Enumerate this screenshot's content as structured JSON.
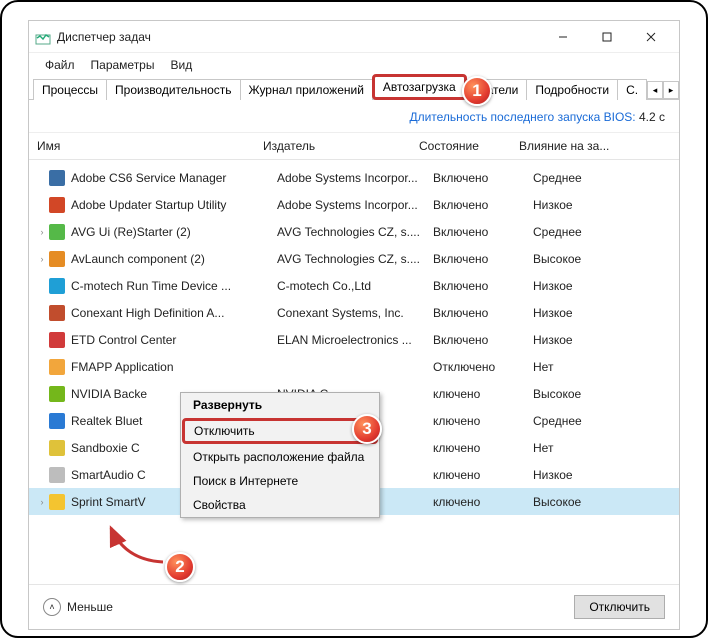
{
  "window": {
    "title": "Диспетчер задач"
  },
  "menu": {
    "file": "Файл",
    "options": "Параметры",
    "view": "Вид"
  },
  "tabs": {
    "t0": "Процессы",
    "t1": "Производительность",
    "t2": "Журнал приложений",
    "t3": "Автозагрузка",
    "t4_partial": "ователи",
    "t5": "Подробности",
    "t6_partial": "С."
  },
  "bios": {
    "label": "Длительность последнего запуска BIOS:",
    "value": "4.2 с"
  },
  "cols": {
    "name": "Имя",
    "publisher": "Издатель",
    "status": "Состояние",
    "impact": "Влияние на за..."
  },
  "rows": [
    {
      "name": "Adobe CS6 Service Manager",
      "pub": "Adobe Systems Incorpor...",
      "stat": "Включено",
      "imp": "Среднее",
      "color": "#3a6ea5",
      "caret": ""
    },
    {
      "name": "Adobe Updater Startup Utility",
      "pub": "Adobe Systems Incorpor...",
      "stat": "Включено",
      "imp": "Низкое",
      "color": "#d24726",
      "caret": ""
    },
    {
      "name": "AVG Ui (Re)Starter (2)",
      "pub": "AVG Technologies CZ, s....",
      "stat": "Включено",
      "imp": "Среднее",
      "color": "#55b948",
      "caret": "›"
    },
    {
      "name": "AvLaunch component (2)",
      "pub": "AVG Technologies CZ, s....",
      "stat": "Включено",
      "imp": "Высокое",
      "color": "#e58c24",
      "caret": "›"
    },
    {
      "name": "C-motech Run Time Device ...",
      "pub": "C-motech Co.,Ltd",
      "stat": "Включено",
      "imp": "Низкое",
      "color": "#1f9fd6",
      "caret": ""
    },
    {
      "name": "Conexant High Definition A...",
      "pub": "Conexant Systems, Inc.",
      "stat": "Включено",
      "imp": "Низкое",
      "color": "#c14d2d",
      "caret": ""
    },
    {
      "name": "ETD Control Center",
      "pub": "ELAN Microelectronics ...",
      "stat": "Включено",
      "imp": "Низкое",
      "color": "#d13a3a",
      "caret": ""
    },
    {
      "name": "FMAPP Application",
      "pub": "",
      "stat": "Отключено",
      "imp": "Нет",
      "color": "#f2a63c",
      "caret": ""
    },
    {
      "name": "NVIDIA Backe",
      "pub": "NVIDIA C",
      "stat": "ключено",
      "imp": "Высокое",
      "color": "#74b71b",
      "caret": ""
    },
    {
      "name": "Realtek Bluet",
      "pub": "",
      "stat": "ключено",
      "imp": "Среднее",
      "color": "#2a7ad4",
      "caret": ""
    },
    {
      "name": "Sandboxie C",
      "pub": "",
      "stat": "ключено",
      "imp": "Нет",
      "color": "#dfc23a",
      "caret": ""
    },
    {
      "name": "SmartAudio C",
      "pub": "",
      "stat": "ключено",
      "imp": "Низкое",
      "color": "#bdbdbd",
      "caret": ""
    },
    {
      "name": "Sprint SmartV",
      "pub": "",
      "stat": "ключено",
      "imp": "Высокое",
      "color": "#f4c430",
      "caret": "›"
    }
  ],
  "ctx": {
    "expand": "Развернуть",
    "disable": "Отключить",
    "open_loc": "Открыть расположение файла",
    "search": "Поиск в Интернете",
    "props": "Свойства"
  },
  "footer": {
    "less": "Меньше",
    "disable_btn": "Отключить"
  },
  "steps": {
    "s1": "1",
    "s2": "2",
    "s3": "3"
  }
}
